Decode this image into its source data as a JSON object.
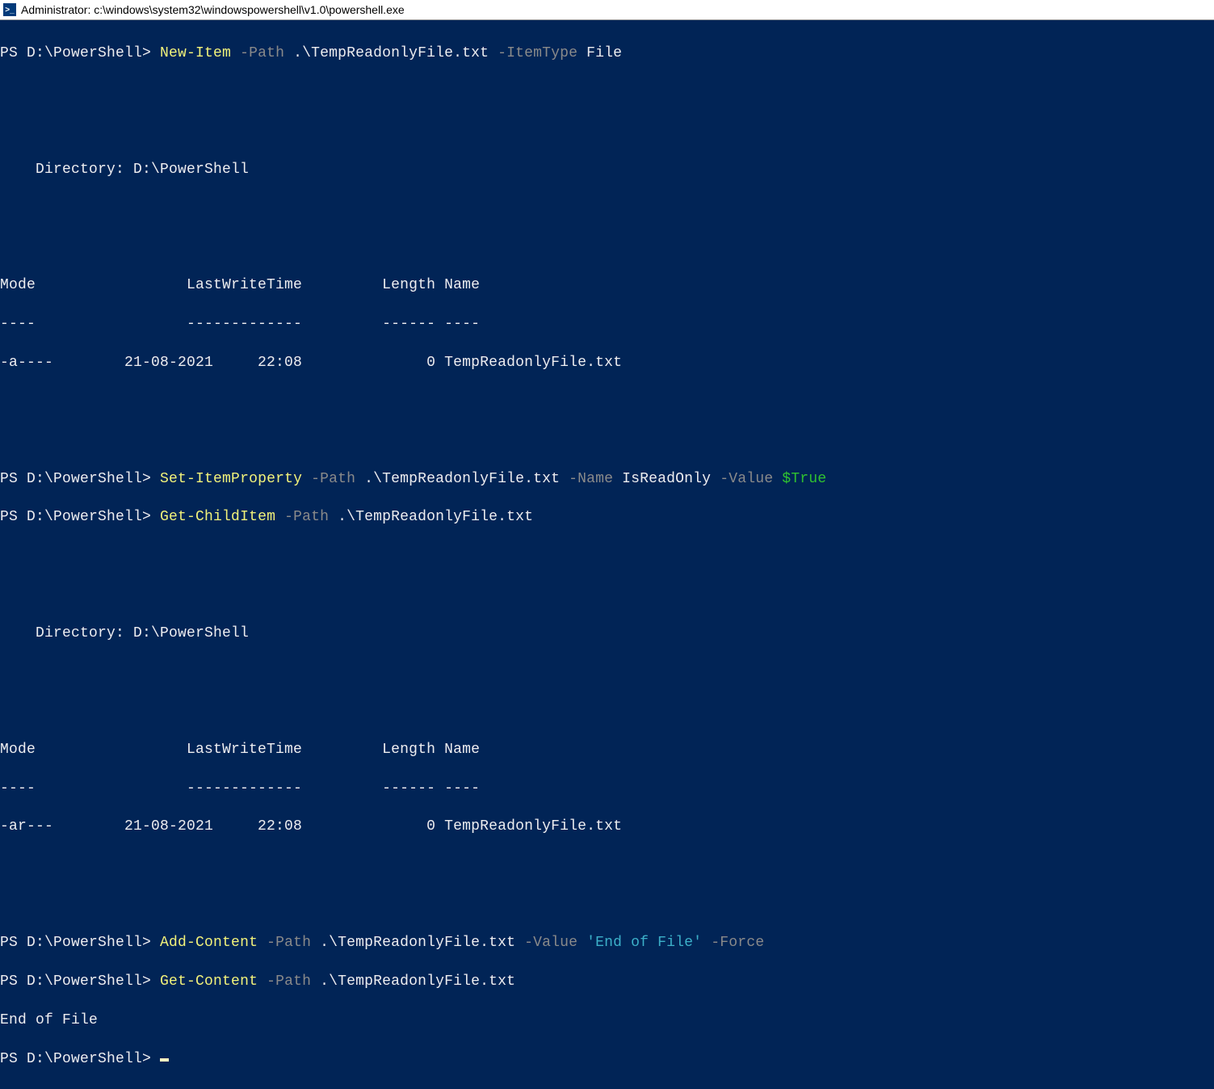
{
  "titlebar": {
    "icon_glyph": ">_",
    "title": "Administrator: c:\\windows\\system32\\windowspowershell\\v1.0\\powershell.exe"
  },
  "lines": {
    "l1_prompt": "PS D:\\PowerShell> ",
    "l1_cmd": "New-Item",
    "l1_p1": " -Path",
    "l1_arg1": " .\\TempReadonlyFile.txt",
    "l1_p2": " -ItemType",
    "l1_arg2": " File",
    "l3_dir": "    Directory: D:\\PowerShell",
    "l5_hdr": "Mode                 LastWriteTime         Length Name",
    "l6_sep": "----                 -------------         ------ ----",
    "l7_row": "-a----        21-08-2021     22:08              0 TempReadonlyFile.txt",
    "l9_prompt": "PS D:\\PowerShell> ",
    "l9_cmd": "Set-ItemProperty",
    "l9_p1": " -Path",
    "l9_arg1": " .\\TempReadonlyFile.txt",
    "l9_p2": " -Name",
    "l9_arg2": " IsReadOnly",
    "l9_p3": " -Value",
    "l9_val": " $True",
    "l10_prompt": "PS D:\\PowerShell> ",
    "l10_cmd": "Get-ChildItem",
    "l10_p1": " -Path",
    "l10_arg1": " .\\TempReadonlyFile.txt",
    "l12_dir": "    Directory: D:\\PowerShell",
    "l14_hdr": "Mode                 LastWriteTime         Length Name",
    "l15_sep": "----                 -------------         ------ ----",
    "l16_row": "-ar---        21-08-2021     22:08              0 TempReadonlyFile.txt",
    "l18_prompt": "PS D:\\PowerShell> ",
    "l18_cmd": "Add-Content",
    "l18_p1": " -Path",
    "l18_arg1": " .\\TempReadonlyFile.txt",
    "l18_p2": " -Value",
    "l18_str": " 'End of File'",
    "l18_p3": " -Force",
    "l19_prompt": "PS D:\\PowerShell> ",
    "l19_cmd": "Get-Content",
    "l19_p1": " -Path",
    "l19_arg1": " .\\TempReadonlyFile.txt",
    "l20_out": "End of File",
    "l21_prompt": "PS D:\\PowerShell> "
  }
}
